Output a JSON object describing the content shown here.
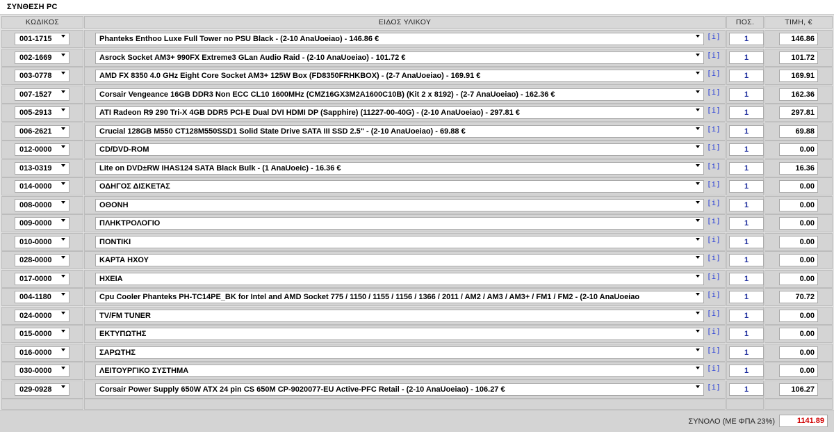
{
  "title": "ΣΥΝΘΕΣΗ PC",
  "headers": {
    "code": "ΚΩΔΙΚΟΣ",
    "item": "ΕΙΔΟΣ ΥΛΙΚΟΥ",
    "qty": "ΠΟΣ.",
    "price": "ΤΙΜΗ, €"
  },
  "info_label": "[i]",
  "rows": [
    {
      "code": "001-1715",
      "item": "Phanteks Enthoo Luxe Full Tower no PSU Black - (2-10 AnaUoeiao) - 146.86 €",
      "qty": "1",
      "price": "146.86"
    },
    {
      "code": "002-1669",
      "item": "Asrock Socket AM3+ 990FX Extreme3 GLan Audio Raid - (2-10 AnaUoeiao) - 101.72 €",
      "qty": "1",
      "price": "101.72"
    },
    {
      "code": "003-0778",
      "item": "AMD FX 8350 4.0 GHz Eight Core Socket AM3+ 125W Box (FD8350FRHKBOX) - (2-7 AnaUoeiao) - 169.91 €",
      "qty": "1",
      "price": "169.91"
    },
    {
      "code": "007-1527",
      "item": "Corsair Vengeance 16GB DDR3 Non ECC CL10 1600MHz (CMZ16GX3M2A1600C10B) (Kit 2 x 8192) - (2-7 AnaUoeiao) - 162.36 €",
      "qty": "1",
      "price": "162.36"
    },
    {
      "code": "005-2913",
      "item": "ATI Radeon R9 290 Tri-X 4GB DDR5 PCI-E Dual DVI HDMI DP (Sapphire) (11227-00-40G) - (2-10 AnaUoeiao) - 297.81 €",
      "qty": "1",
      "price": "297.81"
    },
    {
      "code": "006-2621",
      "item": "Crucial 128GB M550 CT128M550SSD1 Solid State Drive SATA III SSD 2.5\" - (2-10 AnaUoeiao) - 69.88 €",
      "qty": "1",
      "price": "69.88"
    },
    {
      "code": "012-0000",
      "item": "CD/DVD-ROM",
      "qty": "1",
      "price": "0.00"
    },
    {
      "code": "013-0319",
      "item": "Lite on DVD±RW IHAS124 SATA Black Bulk - (1 AnaUoeic) - 16.36 €",
      "qty": "1",
      "price": "16.36"
    },
    {
      "code": "014-0000",
      "item": "ΟΔΗΓΟΣ ΔΙΣΚΕΤΑΣ",
      "qty": "1",
      "price": "0.00"
    },
    {
      "code": "008-0000",
      "item": "ΟΘΟΝΗ",
      "qty": "1",
      "price": "0.00"
    },
    {
      "code": "009-0000",
      "item": "ΠΛΗΚΤΡΟΛΟΓΙΟ",
      "qty": "1",
      "price": "0.00"
    },
    {
      "code": "010-0000",
      "item": "ΠΟΝΤΙΚΙ",
      "qty": "1",
      "price": "0.00"
    },
    {
      "code": "028-0000",
      "item": "ΚΑΡΤΑ ΗΧΟΥ",
      "qty": "1",
      "price": "0.00"
    },
    {
      "code": "017-0000",
      "item": "ΗΧΕΙΑ",
      "qty": "1",
      "price": "0.00"
    },
    {
      "code": "004-1180",
      "item": "Cpu Cooler Phanteks PH-TC14PE_BK for Intel and AMD Socket 775 / 1150 / 1155 / 1156 / 1366 / 2011 / AM2 / AM3 / AM3+ / FM1 / FM2 - (2-10 AnaUoeiao",
      "qty": "1",
      "price": "70.72"
    },
    {
      "code": "024-0000",
      "item": "TV/FM TUNER",
      "qty": "1",
      "price": "0.00"
    },
    {
      "code": "015-0000",
      "item": "ΕΚΤΥΠΩΤΗΣ",
      "qty": "1",
      "price": "0.00"
    },
    {
      "code": "016-0000",
      "item": "ΣΑΡΩΤΗΣ",
      "qty": "1",
      "price": "0.00"
    },
    {
      "code": "030-0000",
      "item": "ΛΕΙΤΟΥΡΓΙΚΟ ΣΥΣΤΗΜΑ",
      "qty": "1",
      "price": "0.00"
    },
    {
      "code": "029-0928",
      "item": "Corsair Power Supply 650W ATX 24 pin CS 650M CP-9020077-EU Active-PFC Retail - (2-10 AnaUoeiao) - 106.27 €",
      "qty": "1",
      "price": "106.27"
    }
  ],
  "total": {
    "label": "ΣΥΝΟΛΟ (ΜΕ ΦΠΑ 23%)",
    "value": "1141.89",
    "color": "#d00000"
  }
}
